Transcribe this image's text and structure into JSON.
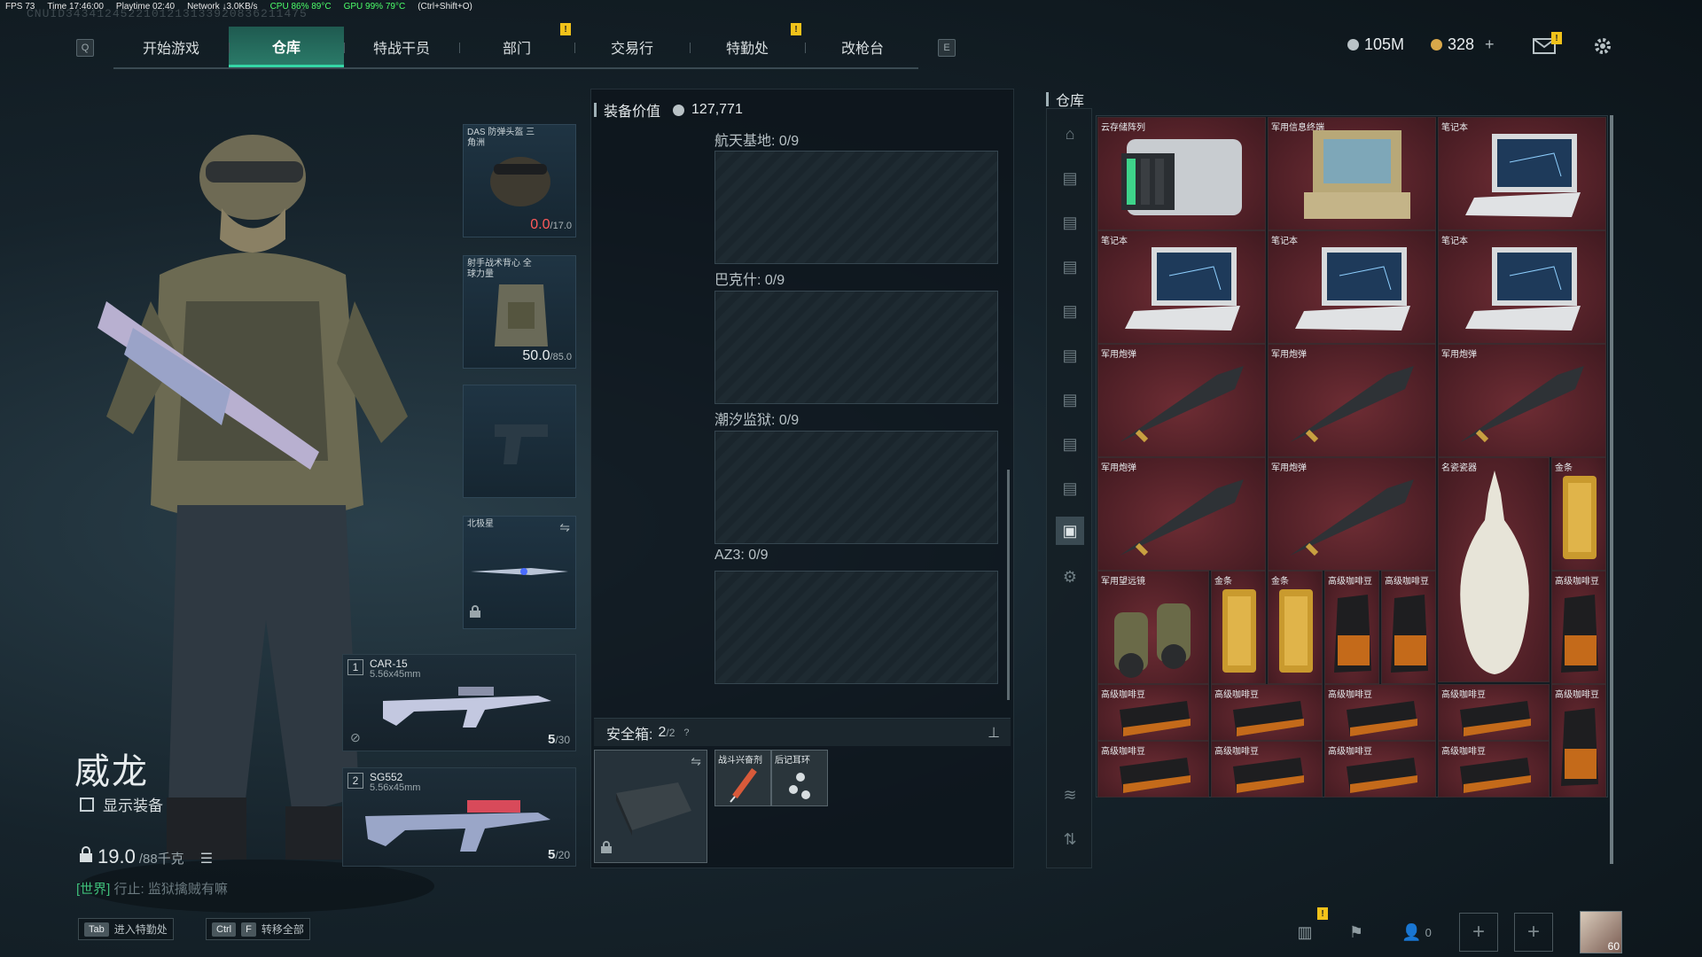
{
  "perf": {
    "fps": "FPS 73",
    "time": "Time 17:46:00",
    "playtime": "Playtime 02:40",
    "network": "Network ↓3.0KB/s",
    "cpu": "CPU 86% 89°C",
    "gpu": "GPU 99% 79°C",
    "shortcut": "(Ctrl+Shift+O)"
  },
  "uid": "CNUID3434124522101213133920836211475",
  "nav": {
    "left_key": "Q",
    "right_key": "E",
    "tabs": [
      "开始游戏",
      "仓库",
      "特战干员",
      "部门",
      "交易行",
      "特勤处",
      "改枪台"
    ],
    "active_tab": "仓库",
    "alert": "!"
  },
  "currency": {
    "silver": "105M",
    "gold": "328",
    "plus": "+",
    "silver_color": "#b9c2c6",
    "gold_color": "#d9a84a"
  },
  "operator": {
    "name": "威龙",
    "show_gear_label": "显示装备",
    "weight": "19.0",
    "weight_max": "/88千克"
  },
  "chat": {
    "channel": "[世界]",
    "text": "行止: 监狱擒贼有嘛"
  },
  "hints": [
    {
      "keys": [
        "Tab"
      ],
      "label": "进入特勤处"
    },
    {
      "keys": [
        "Ctrl",
        "F"
      ],
      "label": "转移全部"
    }
  ],
  "equipment": {
    "helmet": {
      "label": "DAS 防弹头盔 三角洲",
      "durability": "0.0",
      "max": "/17.0"
    },
    "armor": {
      "label": "射手战术背心 全球力量",
      "durability": "50.0",
      "max": "/85.0"
    },
    "pistol": {
      "label": ""
    },
    "melee": {
      "label": "北极星"
    },
    "primary": {
      "num": "1",
      "name": "CAR-15",
      "caliber": "5.56x45mm",
      "ammo": "5",
      "ammo_max": "/30"
    },
    "secondary": {
      "num": "2",
      "name": "SG552",
      "caliber": "5.56x45mm",
      "ammo": "5",
      "ammo_max": "/20"
    }
  },
  "middle": {
    "title": "装备价值",
    "value": "127,771",
    "maps": [
      "航天基地: 0/9",
      "巴克什: 0/9",
      "潮汐监狱: 0/9",
      "AZ3: 0/9"
    ],
    "safe_box": {
      "label": "安全箱:",
      "count": "2",
      "max": "/2",
      "help": "?",
      "items": [
        "战斗兴奋剂",
        "后记耳环"
      ]
    }
  },
  "warehouse": {
    "title": "仓库",
    "items": [
      {
        "label": "云存储阵列",
        "icon": "server-icon"
      },
      {
        "label": "军用信息终端",
        "icon": "terminal-icon"
      },
      {
        "label": "笔记本",
        "icon": "laptop-icon"
      },
      {
        "label": "笔记本",
        "icon": "laptop-icon"
      },
      {
        "label": "笔记本",
        "icon": "laptop-icon"
      },
      {
        "label": "笔记本",
        "icon": "laptop-icon"
      },
      {
        "label": "军用炮弹",
        "icon": "shell-icon"
      },
      {
        "label": "军用炮弹",
        "icon": "shell-icon"
      },
      {
        "label": "军用炮弹",
        "icon": "shell-icon"
      },
      {
        "label": "军用炮弹",
        "icon": "shell-icon"
      },
      {
        "label": "军用炮弹",
        "icon": "shell-icon"
      },
      {
        "label": "名瓷瓷器",
        "icon": "vase-icon"
      },
      {
        "label": "金条",
        "icon": "gold-bar-icon"
      },
      {
        "label": "军用望远镜",
        "icon": "binoculars-icon"
      },
      {
        "label": "金条",
        "icon": "gold-bar-icon"
      },
      {
        "label": "金条",
        "icon": "gold-bar-icon"
      },
      {
        "label": "高级咖啡豆",
        "icon": "coffee-bag-icon"
      },
      {
        "label": "高级咖啡豆",
        "icon": "coffee-bag-icon"
      },
      {
        "label": "高级咖啡豆",
        "icon": "coffee-bag-icon"
      },
      {
        "label": "高级咖啡豆",
        "icon": "coffee-pack-icon"
      },
      {
        "label": "高级咖啡豆",
        "icon": "coffee-pack-icon"
      },
      {
        "label": "高级咖啡豆",
        "icon": "coffee-pack-icon"
      },
      {
        "label": "高级咖啡豆",
        "icon": "coffee-pack-icon"
      },
      {
        "label": "高级咖啡豆",
        "icon": "coffee-bag-icon"
      },
      {
        "label": "高级咖啡豆",
        "icon": "coffee-pack-icon"
      },
      {
        "label": "高级咖啡豆",
        "icon": "coffee-pack-icon"
      },
      {
        "label": "高级咖啡豆",
        "icon": "coffee-pack-icon"
      },
      {
        "label": "高级咖啡豆",
        "icon": "coffee-pack-icon"
      }
    ],
    "cell_color": "#5a232a"
  },
  "bottom_right": {
    "friends_count": "0",
    "avatar_level": "60"
  }
}
